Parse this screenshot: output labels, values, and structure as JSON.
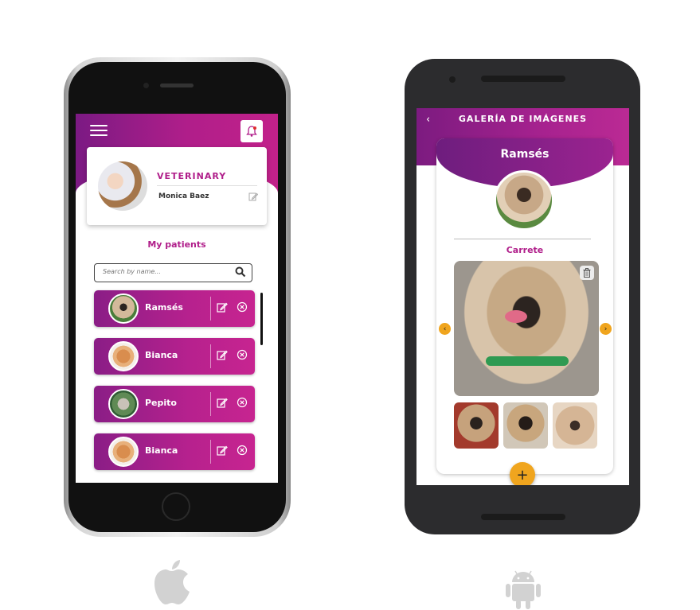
{
  "ios_app": {
    "profile": {
      "role": "VETERINARY",
      "name": "Monica Baez"
    },
    "patients_title": "My patients",
    "search": {
      "placeholder": "Search by name..."
    },
    "patients": [
      {
        "name": "Ramsés"
      },
      {
        "name": "Bianca"
      },
      {
        "name": "Pepito"
      },
      {
        "name": "Bianca"
      }
    ]
  },
  "android_app": {
    "header_title": "GALERÍA DE IMÁGENES",
    "pet_name": "Ramsés",
    "section_title": "Carrete",
    "fab_label": "+"
  },
  "colors": {
    "primary": "#b01e8a",
    "primary_dark": "#7b1a83",
    "accent": "#f0a51e"
  },
  "icons": [
    "hamburger-menu-icon",
    "bell-icon",
    "edit-icon",
    "search-icon",
    "close-circle-icon",
    "back-arrow-icon",
    "trash-icon",
    "chevron-left-icon",
    "chevron-right-icon",
    "plus-icon",
    "apple-logo-icon",
    "android-logo-icon"
  ]
}
